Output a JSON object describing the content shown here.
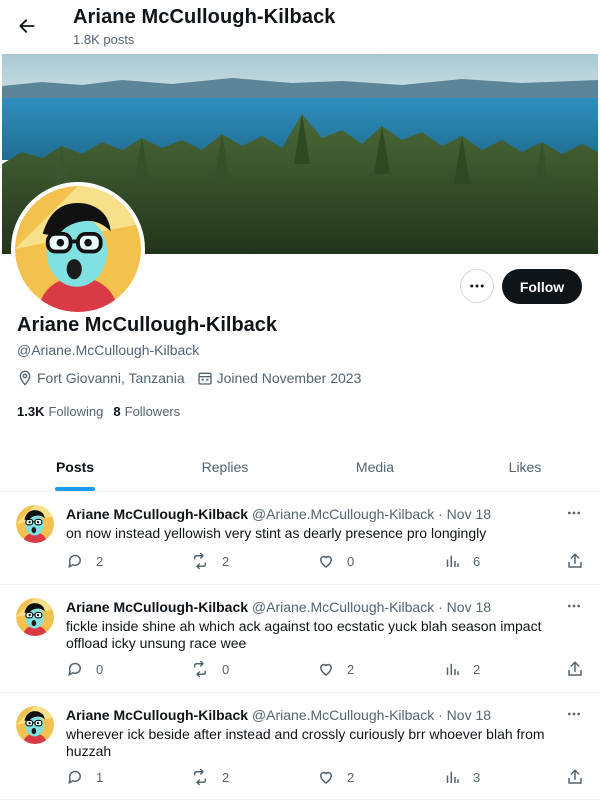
{
  "header": {
    "title": "Ariane McCullough-Kilback",
    "subtitle": "1.8K posts"
  },
  "profile": {
    "name": "Ariane McCullough-Kilback",
    "handle": "@Ariane.McCullough-Kilback",
    "location": "Fort Giovanni, Tanzania",
    "joined": "Joined November 2023",
    "following_count": "1.3K",
    "following_label": "Following",
    "followers_count": "8",
    "followers_label": "Followers",
    "follow_label": "Follow"
  },
  "tabs": [
    {
      "label": "Posts",
      "active": true
    },
    {
      "label": "Replies",
      "active": false
    },
    {
      "label": "Media",
      "active": false
    },
    {
      "label": "Likes",
      "active": false
    }
  ],
  "posts": [
    {
      "name": "Ariane McCullough-Kilback",
      "handle": "@Ariane.McCullough-Kilback",
      "date": "Nov 18",
      "text": "on now instead yellowish very stint as dearly presence pro longingly",
      "replies": "2",
      "reposts": "2",
      "likes": "0",
      "views": "6"
    },
    {
      "name": "Ariane McCullough-Kilback",
      "handle": "@Ariane.McCullough-Kilback",
      "date": "Nov 18",
      "text": "fickle inside shine ah which ack against too ecstatic yuck blah season impact offload icky unsung race wee",
      "replies": "0",
      "reposts": "0",
      "likes": "2",
      "views": "2"
    },
    {
      "name": "Ariane McCullough-Kilback",
      "handle": "@Ariane.McCullough-Kilback",
      "date": "Nov 18",
      "text": "wherever ick beside after instead and crossly curiously brr whoever blah from huzzah",
      "replies": "1",
      "reposts": "2",
      "likes": "2",
      "views": "3"
    }
  ],
  "colors": {
    "accent": "#1d9bf0",
    "text": "#0f1419",
    "muted": "#536471",
    "follow_bg": "#0f1419"
  }
}
